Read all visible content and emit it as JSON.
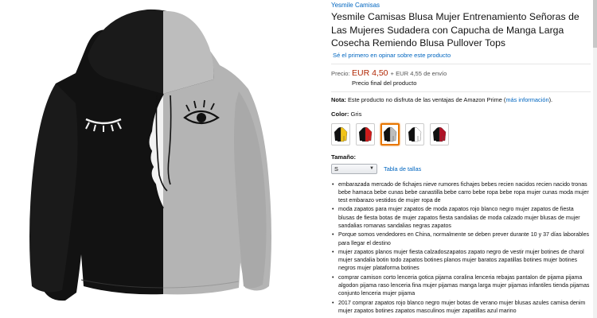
{
  "product": {
    "brand": "Yesmile Camisas",
    "title": "Yesmile Camisas Blusa Mujer Entrenamiento Señoras de Las Mujeres Sudadera con Capucha de Manga Larga Cosecha Remiendo Blusa Pullover Tops",
    "review_link": "Sé el primero en opinar sobre este producto"
  },
  "price": {
    "label": "Precio:",
    "value": "EUR 4,50",
    "shipping": "+ EUR 4,55 de envío",
    "final": "Precio final del producto"
  },
  "note": {
    "label": "Nota:",
    "text": " Este producto no disfruta de las ventajas de Amazon Prime (",
    "link": "más información",
    "end": ")."
  },
  "color": {
    "label": "Color:",
    "value": "Gris",
    "swatches": [
      {
        "name": "yellow",
        "accent": "#f2c41a"
      },
      {
        "name": "red",
        "accent": "#d11a1a"
      },
      {
        "name": "gray",
        "accent": "#bdbdbd"
      },
      {
        "name": "white",
        "accent": "#ffffff"
      },
      {
        "name": "wine",
        "accent": "#b01226"
      }
    ],
    "selected_index": 2
  },
  "size": {
    "label": "Tamaño:",
    "selected": "S",
    "size_chart": "Tabla de tallas"
  },
  "bullets": [
    "embarazada mercado de fichajes nieve rumores fichajes bebes recien nacidos recien nacido tronas bebe hamaca bebe cunas bebe canastilla bebe carro bebe ropa bebe ropa mujer cunas moda mujer test embarazo vestidos de mujer ropa de",
    "moda zapatos para mujer zapatos de moda zapatos rojo blanco negro mujer zapatos de fiesta blusas de fiesta botas de mujer zapatos fiesta sandalias de moda calzado mujer blusas de mujer sandalias romanas sandalias negras zapatos",
    "Porque somos vendedores en China, normalmente se deben prever durante 10 y 37 días laborables para llegar el destino",
    "mujer zapatos planos mujer fiesta calzadoszapatos zapato negro de vestir mujer botines de charol mujer sandalia botin todo zapatos botines planos mujer baratos zapatillas botines mujer botines negros mujer plataforma botines",
    "comprar camison corto lenceria gotica pijama coralina lenceria rebajas pantalon de pijama pijama algodon pijama raso lenceria fina mujer pijamas manga larga mujer pijamas infantiles tienda pijamas conjunto lenceria mujer pijama",
    "2017 comprar zapatos rojo blanco negro mujer botas de verano mujer blusas azules camisa denim mujer zapatos botines zapatos masculinos mujer zapatillas azul marino"
  ],
  "colors": {
    "link": "#0066c0",
    "price": "#b12704",
    "hoodie_black": "#111111",
    "hoodie_gray": "#b4b4b4",
    "selected_border": "#e77600"
  }
}
